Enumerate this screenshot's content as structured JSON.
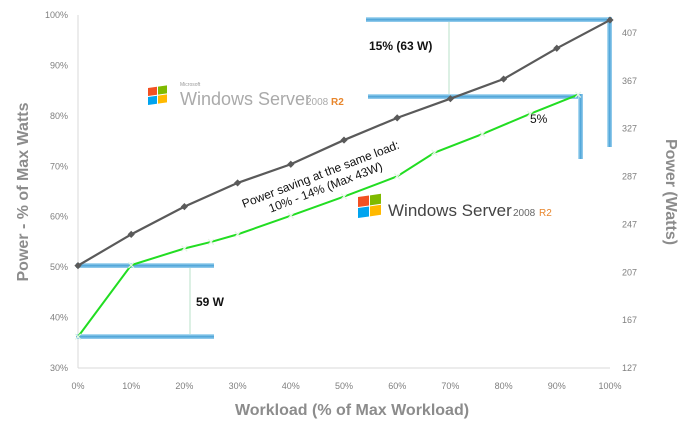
{
  "chart_data": {
    "type": "line",
    "xlabel": "Workload (% of Max Workload)",
    "ylabel": "Power - % of Max Watts",
    "y2label": "Power (Watts)",
    "x_ticks": [
      "0%",
      "10%",
      "20%",
      "30%",
      "40%",
      "50%",
      "60%",
      "70%",
      "80%",
      "90%",
      "100%"
    ],
    "y_ticks": [
      "30%",
      "40%",
      "50%",
      "60%",
      "70%",
      "80%",
      "90%",
      "100%"
    ],
    "y2_ticks": [
      "127",
      "167",
      "207",
      "247",
      "287",
      "327",
      "367",
      "407"
    ],
    "xlim": [
      0,
      100
    ],
    "ylim": [
      30,
      100
    ],
    "series": [
      {
        "name": "Windows Server 2008",
        "color": "#5a5a5a",
        "marker": "diamond",
        "x": [
          0,
          10,
          20,
          30,
          40,
          50,
          60,
          70,
          80,
          90,
          100
        ],
        "values": [
          50.3,
          56.5,
          62.0,
          66.7,
          70.4,
          75.2,
          79.6,
          83.4,
          87.3,
          93.4,
          99.0
        ]
      },
      {
        "name": "Windows Server 2008 R2",
        "color": "#22dd22",
        "marker": "x",
        "x": [
          0,
          10,
          20,
          25,
          30,
          40,
          50,
          60,
          67,
          76,
          85,
          94
        ],
        "values": [
          36.2,
          50.4,
          53.7,
          55.0,
          56.5,
          60.2,
          64.0,
          68.0,
          72.7,
          76.4,
          80.4,
          84.2
        ]
      }
    ],
    "annotations": {
      "top_saving": "15% (63 W)",
      "mid_saving": "5%",
      "bottom_saving": "59 W",
      "rotated_line1": "Power saving at the same load:",
      "rotated_line2": "10% - 14% (Max 43W)"
    },
    "logos": {
      "upper": {
        "pre": "Windows Server",
        "ver": "2008",
        "suffix": "R2",
        "brand": "Microsoft"
      },
      "lower": {
        "pre": "Windows Server",
        "ver": "2008",
        "suffix": "R2"
      }
    }
  }
}
